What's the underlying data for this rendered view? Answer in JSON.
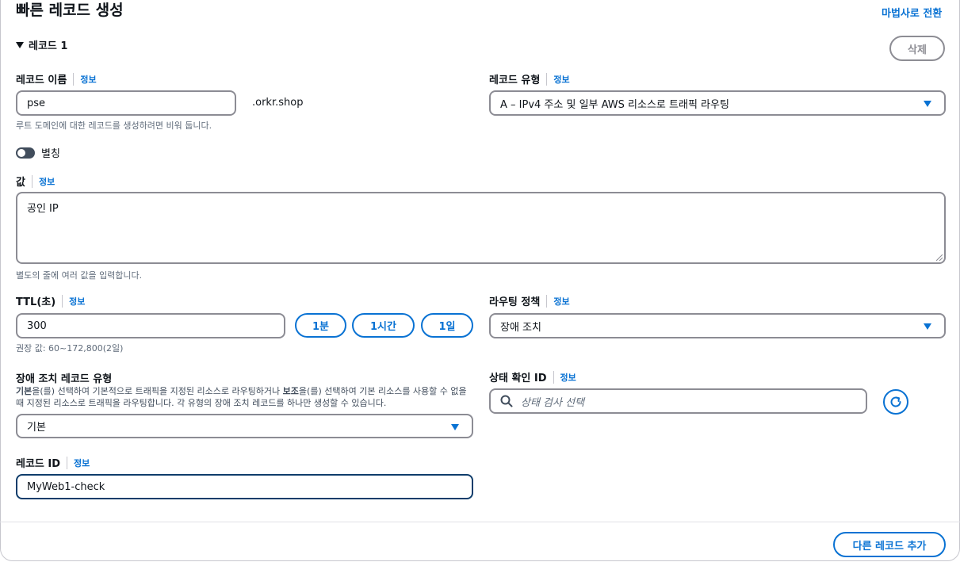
{
  "header": {
    "title": "빠른 레코드 생성",
    "wizard_link": "마법사로 전환"
  },
  "record": {
    "section_label": "레코드 1",
    "delete_label": "삭제",
    "info_label": "정보",
    "name": {
      "label": "레코드 이름",
      "value": "pse",
      "suffix": ".orkr.shop",
      "hint": "루트 도메인에 대한 레코드를 생성하려면 비워 둡니다."
    },
    "type": {
      "label": "레코드 유형",
      "value": "A – IPv4 주소 및 일부 AWS 리소스로 트래픽 라우팅"
    },
    "alias": {
      "label": "별칭",
      "enabled": false
    },
    "value": {
      "label": "값",
      "content": "공인 IP",
      "hint": "별도의 줄에 여러 값을 입력합니다."
    },
    "ttl": {
      "label": "TTL(초)",
      "value": "300",
      "hint": "권장 값: 60~172,800(2일)",
      "presets": [
        "1분",
        "1시간",
        "1일"
      ]
    },
    "routing_policy": {
      "label": "라우팅 정책",
      "value": "장애 조치"
    },
    "failover_type": {
      "label": "장애 조치 레코드 유형",
      "desc_bold1": "기본",
      "desc_part1": "을(를) 선택하여 기본적으로 트래픽을 지정된 리소스로 라우팅하거나 ",
      "desc_bold2": "보조",
      "desc_part2": "을(를) 선택하여 기본 리소스를 사용할 수 없을 때 지정된 리소스로 트래픽을 라우팅합니다. 각 유형의 장애 조치 레코드를 하나만 생성할 수 있습니다.",
      "value": "기본"
    },
    "health_check": {
      "label": "상태 확인 ID",
      "placeholder": "상태 검사 선택"
    },
    "record_id": {
      "label": "레코드 ID",
      "value": "MyWeb1-check"
    }
  },
  "footer": {
    "add_record_label": "다른 레코드 추가"
  },
  "colors": {
    "accent": "#0972d3",
    "focus_border": "#0f3d6b",
    "text": "#0f141a"
  }
}
